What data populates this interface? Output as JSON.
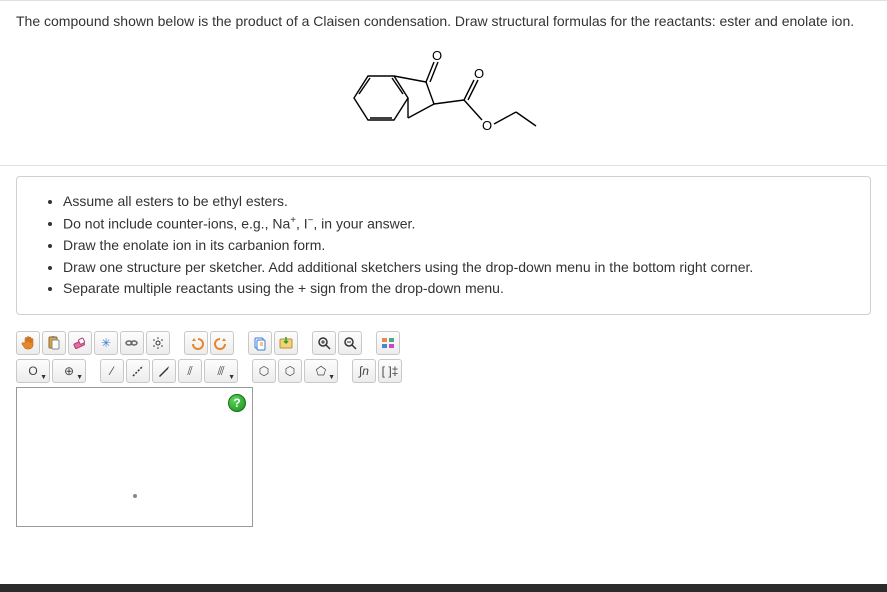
{
  "question": {
    "prompt": "The compound shown below is the product of a Claisen condensation. Draw structural formulas for the reactants: ester and enolate ion."
  },
  "instructions": {
    "items": [
      "Assume all esters to be ethyl esters.",
      "Do not include counter-ions, e.g., Na⁺, I⁻, in your answer.",
      "Draw the enolate ion in its carbanion form.",
      "Draw one structure per sketcher. Add additional sketchers using the drop-down menu in the bottom right corner.",
      "Separate multiple reactants using the + sign from the drop-down menu."
    ]
  },
  "toolbar1": {
    "tools": [
      {
        "name": "hand-tool",
        "glyph_type": "svg",
        "svg_key": "hand"
      },
      {
        "name": "paste-tool",
        "glyph_type": "svg",
        "svg_key": "paste"
      },
      {
        "name": "eraser-tool",
        "glyph_type": "svg",
        "svg_key": "eraser"
      },
      {
        "name": "center-tool",
        "glyph": "✳",
        "color": "#3a7bd5"
      },
      {
        "name": "chain-tool",
        "glyph_type": "svg",
        "svg_key": "chain"
      },
      {
        "name": "clean-tool",
        "glyph_type": "svg",
        "svg_key": "spray"
      },
      {
        "name": "undo-tool",
        "glyph_type": "svg",
        "svg_key": "undo"
      },
      {
        "name": "redo-tool",
        "glyph_type": "svg",
        "svg_key": "redo"
      },
      {
        "name": "copy-tool",
        "glyph_type": "svg",
        "svg_key": "copy"
      },
      {
        "name": "import-tool",
        "glyph_type": "svg",
        "svg_key": "import"
      },
      {
        "name": "zoom-in-tool",
        "glyph_type": "svg",
        "svg_key": "zoomin"
      },
      {
        "name": "zoom-out-tool",
        "glyph_type": "svg",
        "svg_key": "zoomout"
      },
      {
        "name": "periodic-tool",
        "glyph_type": "svg",
        "svg_key": "periodic"
      }
    ]
  },
  "toolbar2": {
    "tools": [
      {
        "name": "element-o",
        "glyph": "O",
        "wide": true,
        "dropdown": true
      },
      {
        "name": "charge-plus",
        "glyph": "⊕",
        "wide": true,
        "dropdown": true
      },
      {
        "name": "single-bond",
        "glyph": "⁄"
      },
      {
        "name": "dashed-bond",
        "glyph_type": "svg",
        "svg_key": "dashed"
      },
      {
        "name": "wedge-bond",
        "glyph_type": "svg",
        "svg_key": "wedge"
      },
      {
        "name": "double-bond",
        "glyph": "⫽"
      },
      {
        "name": "triple-bond",
        "glyph": "⫻",
        "wide": true,
        "dropdown": true
      },
      {
        "name": "benzene-ring",
        "glyph": "⬡"
      },
      {
        "name": "cyclohexane",
        "glyph": "⬡"
      },
      {
        "name": "cyclopentane",
        "glyph": "⬠",
        "wide": true,
        "dropdown": true
      },
      {
        "name": "custom-fn",
        "glyph": "∫n",
        "italic": true
      },
      {
        "name": "bracket-tool",
        "glyph": "[ ]‡"
      }
    ]
  },
  "help": {
    "label": "?"
  },
  "colors": {
    "icon_orange": "#e8862a",
    "icon_blue": "#3a7bd5",
    "icon_pink": "#e66aa3",
    "icon_green": "#2e9e2e",
    "icon_gray": "#666"
  }
}
